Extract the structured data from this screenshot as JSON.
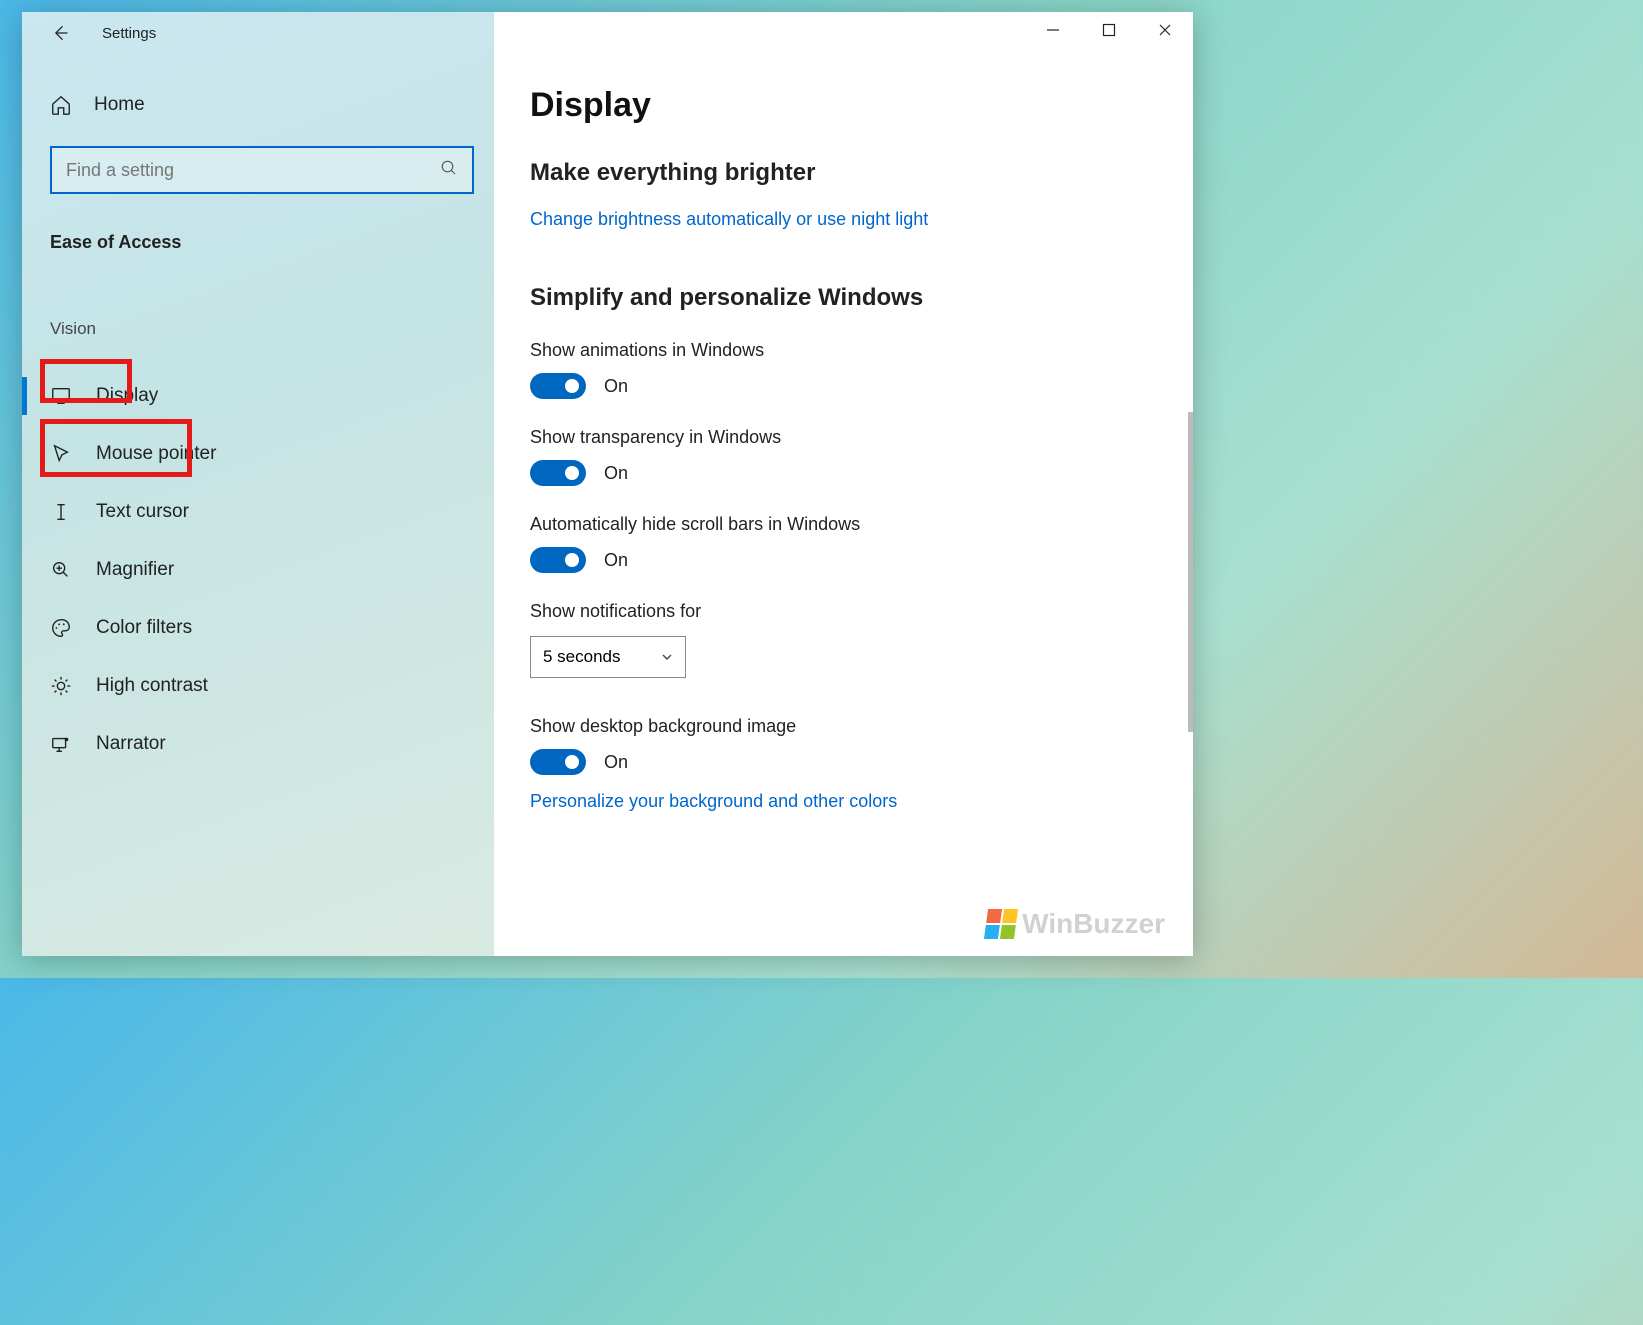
{
  "window": {
    "title": "Settings",
    "minimize": "–",
    "maximize": "□",
    "close": "✕"
  },
  "sidebar": {
    "home": "Home",
    "search_placeholder": "Find a setting",
    "category": "Ease of Access",
    "group": "Vision",
    "items": [
      {
        "label": "Display",
        "icon": "display"
      },
      {
        "label": "Mouse pointer",
        "icon": "mouse"
      },
      {
        "label": "Text cursor",
        "icon": "textcursor"
      },
      {
        "label": "Magnifier",
        "icon": "magnifier"
      },
      {
        "label": "Color filters",
        "icon": "palette"
      },
      {
        "label": "High contrast",
        "icon": "contrast"
      },
      {
        "label": "Narrator",
        "icon": "narrator"
      }
    ]
  },
  "main": {
    "page_title": "Display",
    "section1": "Make everything brighter",
    "link_brightness": "Change brightness automatically or use night light",
    "section2": "Simplify and personalize Windows",
    "settings": {
      "animations": {
        "label": "Show animations in Windows",
        "state": "On"
      },
      "transparency": {
        "label": "Show transparency in Windows",
        "state": "On"
      },
      "scrollbars": {
        "label": "Automatically hide scroll bars in Windows",
        "state": "On"
      },
      "notifications": {
        "label": "Show notifications for",
        "value": "5 seconds"
      },
      "background": {
        "label": "Show desktop background image",
        "state": "On"
      }
    },
    "link_personalize": "Personalize your background and other colors"
  },
  "watermark": "WinBuzzer"
}
